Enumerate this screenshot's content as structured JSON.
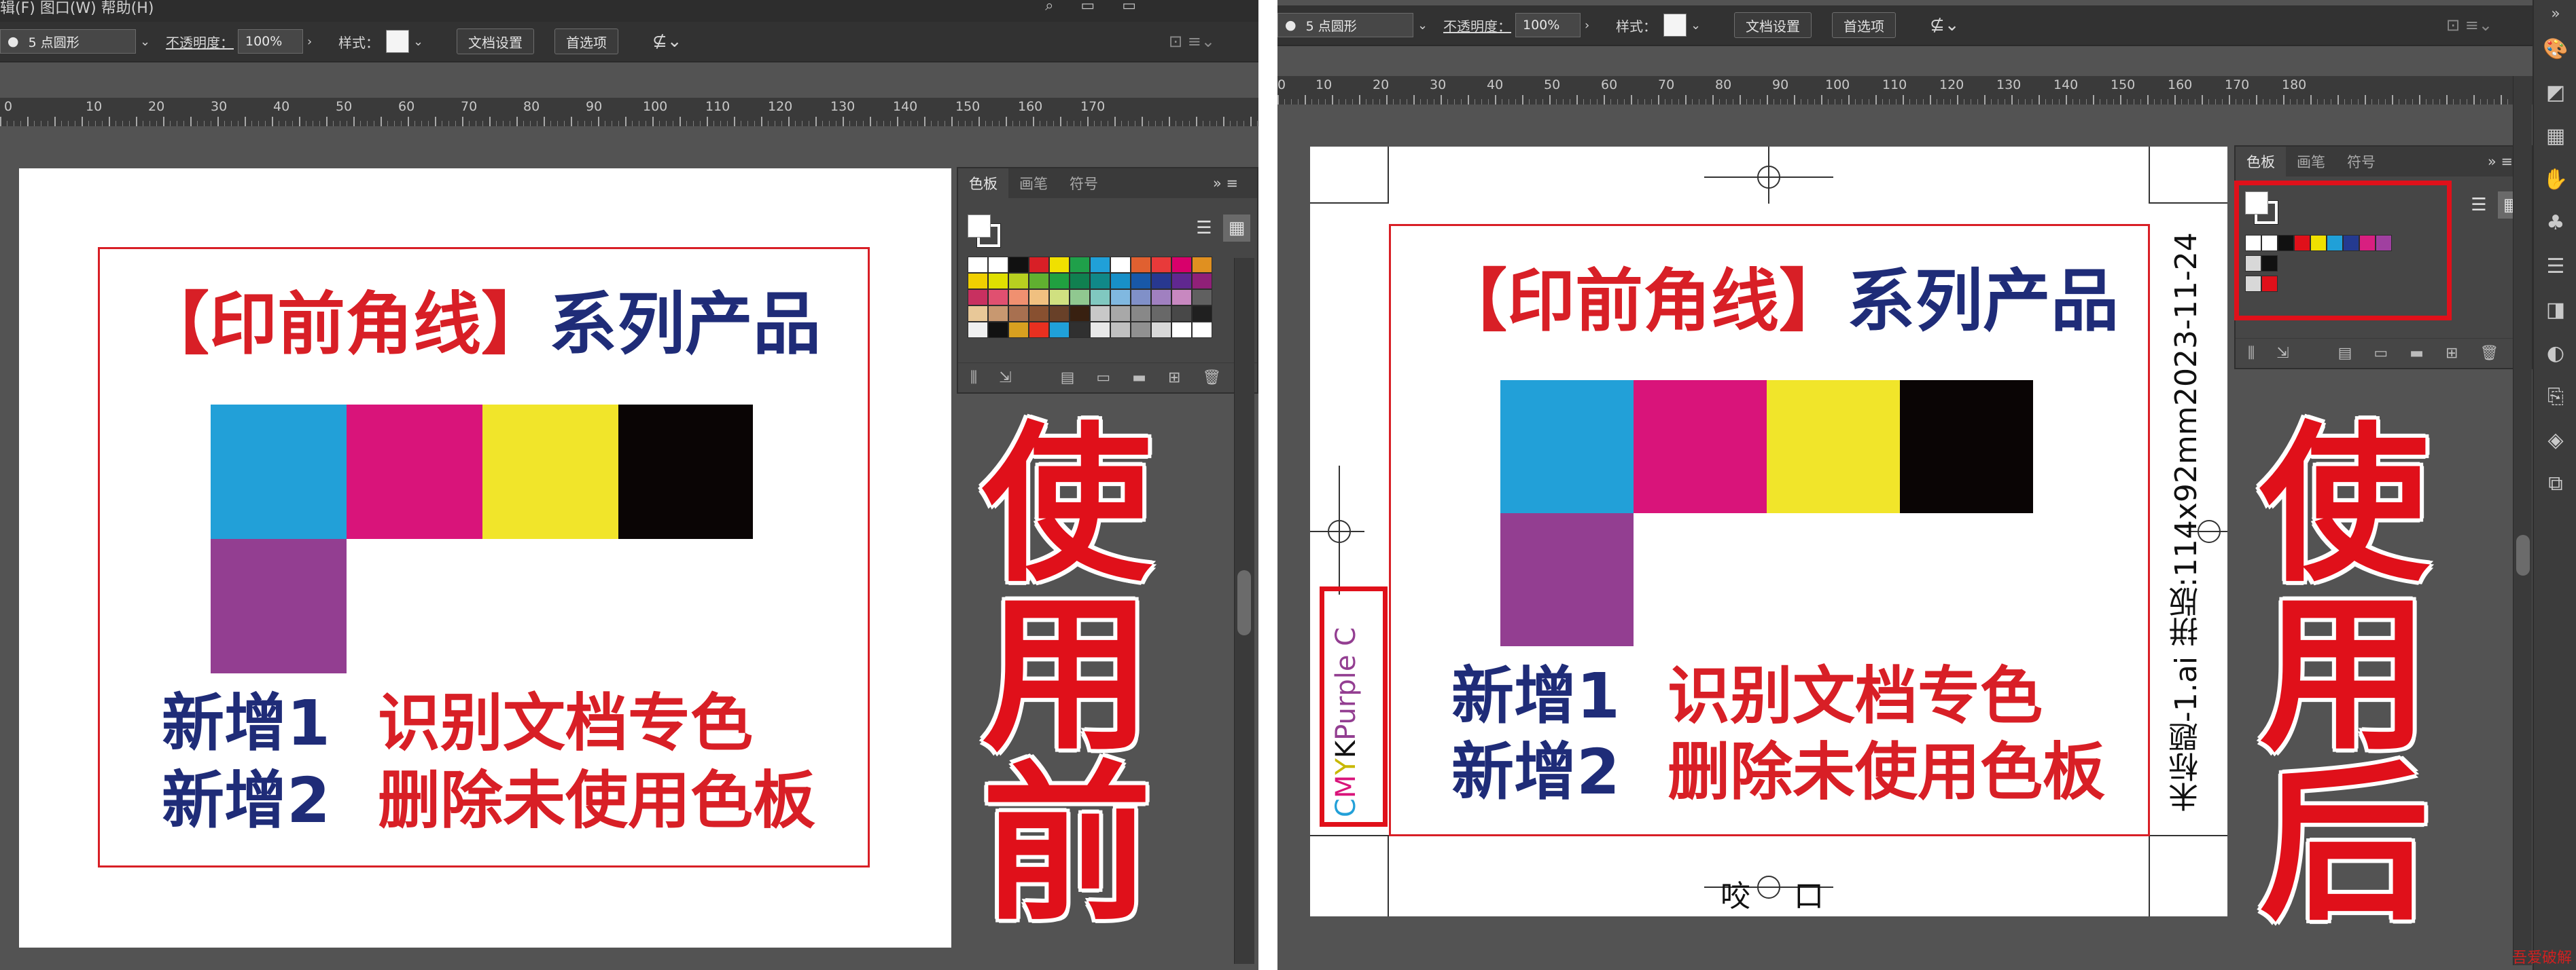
{
  "left": {
    "menu_fragment": "辑(F) 图口(W) 帮助(H)",
    "control": {
      "stroke_profile": "5 点圆形",
      "opacity_label": "不透明度：",
      "opacity_value": "100%",
      "style_label": "样式：",
      "doc_settings": "文档设置",
      "preferences": "首选项"
    },
    "ruler": [
      "0",
      "10",
      "20",
      "30",
      "40",
      "50",
      "60",
      "70",
      "80",
      "90",
      "100",
      "110",
      "120",
      "130",
      "140",
      "150",
      "160",
      "170"
    ],
    "artboard": {
      "title_red": "【印前角线】",
      "title_navy": "系列产品",
      "row1_label": "新增1",
      "row1_text": "识别文档专色",
      "row2_label": "新增2",
      "row2_text": "删除未使用色板"
    },
    "panel": {
      "tabs": [
        "色板",
        "画笔",
        "符号"
      ],
      "swatches": [
        "#ffffff",
        "#ffffff",
        "#111111",
        "#d81f26",
        "#f0e000",
        "#1fa04a",
        "#20a0d8",
        "#ffffff",
        "#e06030",
        "#e83a3a",
        "#d8006b",
        "#e09020",
        "#f0d000",
        "#e0e000",
        "#b8d020",
        "#60b030",
        "#20a040",
        "#108050",
        "#108888",
        "#1890c8",
        "#1858a8",
        "#283890",
        "#602890",
        "#902078",
        "#c83060",
        "#e05070",
        "#f09070",
        "#f0c080",
        "#d0e080",
        "#90c890",
        "#80c8c0",
        "#80b8e0",
        "#8090c8",
        "#a080c0",
        "#c888c0",
        "#606060",
        "#e8c898",
        "#c89870",
        "#a87050",
        "#885030",
        "#684028",
        "#382010",
        "#c8c8c8",
        "#a8a8a8",
        "#888888",
        "#686868",
        "#484848",
        "#202020",
        "#f0f0f0",
        "#111111",
        "#d8a020",
        "#e83020",
        "#20a0d8",
        "#303030",
        "#e8e8e8",
        "#c0c0c0",
        "#909090",
        "#d8d8d8",
        "#ffffff",
        "#ffffff"
      ]
    },
    "biglabel": [
      "使",
      "用",
      "前"
    ]
  },
  "right": {
    "control": {
      "stroke_profile": "5 点圆形",
      "opacity_label": "不透明度：",
      "opacity_value": "100%",
      "style_label": "样式：",
      "doc_settings": "文档设置",
      "preferences": "首选项"
    },
    "ruler": [
      "0",
      "10",
      "20",
      "30",
      "40",
      "50",
      "60",
      "70",
      "80",
      "90",
      "100",
      "110",
      "120",
      "130",
      "140",
      "150",
      "160",
      "170",
      "180"
    ],
    "artboard": {
      "title_red": "【印前角线】",
      "title_navy": "系列产品",
      "row1_label": "新增1",
      "row1_text": "识别文档专色",
      "row2_label": "新增2",
      "row2_text": "删除未使用色板",
      "side_info_date": "2023-11-24",
      "side_info_meta": "未标题-1.ai  拼版:114x92mm",
      "spot_c": "C",
      "spot_m": "M",
      "spot_y": "Y",
      "spot_k": "K",
      "spot_name": "Purple C",
      "bite_label_1": "咬",
      "bite_label_2": "口"
    },
    "panel": {
      "tabs": [
        "色板",
        "画笔",
        "符号"
      ],
      "swatches": [
        "#111111",
        "#e0101a",
        "#f0e000",
        "#20a0d8",
        "#243a90",
        "#d81f80",
        "#a040a0"
      ]
    },
    "biglabel": [
      "使",
      "用",
      "后"
    ]
  },
  "watermark": "吾爱破解"
}
